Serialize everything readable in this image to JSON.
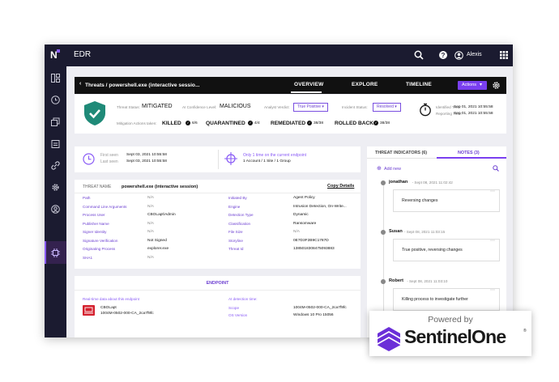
{
  "app": {
    "logo": "N",
    "title": "EDR",
    "user": "Alexis"
  },
  "breadcrumb": "Threats / powershell.exe (interactive sessio...",
  "tabs": [
    {
      "label": "OVERVIEW",
      "active": true
    },
    {
      "label": "EXPLORE"
    },
    {
      "label": "TIMELINE"
    }
  ],
  "actions_label": "Actions",
  "summary": {
    "status_label": "Threat Status:",
    "status": "MITIGATED",
    "ai_label": "AI Confidence Level:",
    "ai": "MALICIOUS",
    "verdict_label": "Analyst Verdict:",
    "verdict": "True Positive",
    "incident_label": "Incident Status:",
    "incident": "Resolved",
    "identified_label": "Identified Time:",
    "identified": "Sep 01, 2021 10:55:58",
    "reporting_label": "Reporting Time:",
    "reporting": "Sep 01, 2021 10:55:58",
    "mitigation_label": "Mitigation Actions taken:",
    "actions": [
      {
        "name": "KILLED",
        "count": "6/6"
      },
      {
        "name": "QUARANTINED",
        "count": "4/4"
      },
      {
        "name": "REMEDIATED",
        "count": "38/38"
      },
      {
        "name": "ROLLED BACK",
        "count": "38/38"
      }
    ]
  },
  "seen": {
    "first_label": "First seen",
    "first": "Sept 03, 2021 10:55:58",
    "last_label": "Last seen",
    "last": "Sept 03, 2021 10:55:58",
    "only": "Only 1 time on the current endpoint",
    "scope": "1 Account / 1 Site / 1 Group"
  },
  "threat": {
    "name_label": "THREAT NAME",
    "name": "powershell.exe (interactive session)",
    "copy": "Copy Details",
    "left": [
      [
        "Path",
        "N/A"
      ],
      [
        "Command Line Arguments",
        "N/A"
      ],
      [
        "Process User",
        "CBOLapt\\Admin"
      ],
      [
        "Publisher Name",
        "N/A"
      ],
      [
        "Signer Identity",
        "N/A"
      ],
      [
        "Signature Verification",
        "Not Signed"
      ],
      [
        "Originating Process",
        "explorer.exe"
      ],
      [
        "SHA1",
        "N/A"
      ]
    ],
    "right": [
      [
        "Initiated By",
        "Agent Policy"
      ],
      [
        "Engine",
        "Intrusion Detection, On-Write..."
      ],
      [
        "Detection Type",
        "Dynamic"
      ],
      [
        "Classification",
        "Ransomware"
      ],
      [
        "File Size",
        "N/A"
      ],
      [
        "Storyline",
        "0E7D3F2B9C1787D"
      ],
      [
        "Threat Id",
        "1385018308475093883"
      ]
    ]
  },
  "endpoint": {
    "title": "ENDPOINT",
    "realtime": "Real-time data about this endpoint",
    "name": "CBOLapt",
    "id": "1004M-0502-000-CA_2ca7f9fc",
    "at_detection": "At detection time:",
    "scope_label": "Scope",
    "scope": "1004M-0502-000-CA_2ca7f9fc",
    "os_label": "OS Version",
    "os": "Windows 10 Pro 15056"
  },
  "right_panel": {
    "tab_indicators": "THREAT INDICATORS (6)",
    "tab_notes": "NOTES (3)",
    "add_new": "Add new",
    "notes": [
      {
        "author": "jonathan",
        "date": "- Sept 08, 2021 11:02:42",
        "text": "Reversing changes"
      },
      {
        "author": "Susan",
        "date": "- Sept 08, 2021 11:03:15",
        "text": "True positive, reversing changes"
      },
      {
        "author": "Robert",
        "date": "- Sept 08, 2021 11:03:10",
        "text": "Killing process to investigate further"
      }
    ]
  },
  "badge": {
    "powered": "Powered by",
    "brand": "SentinelOne",
    "tm": "®"
  }
}
